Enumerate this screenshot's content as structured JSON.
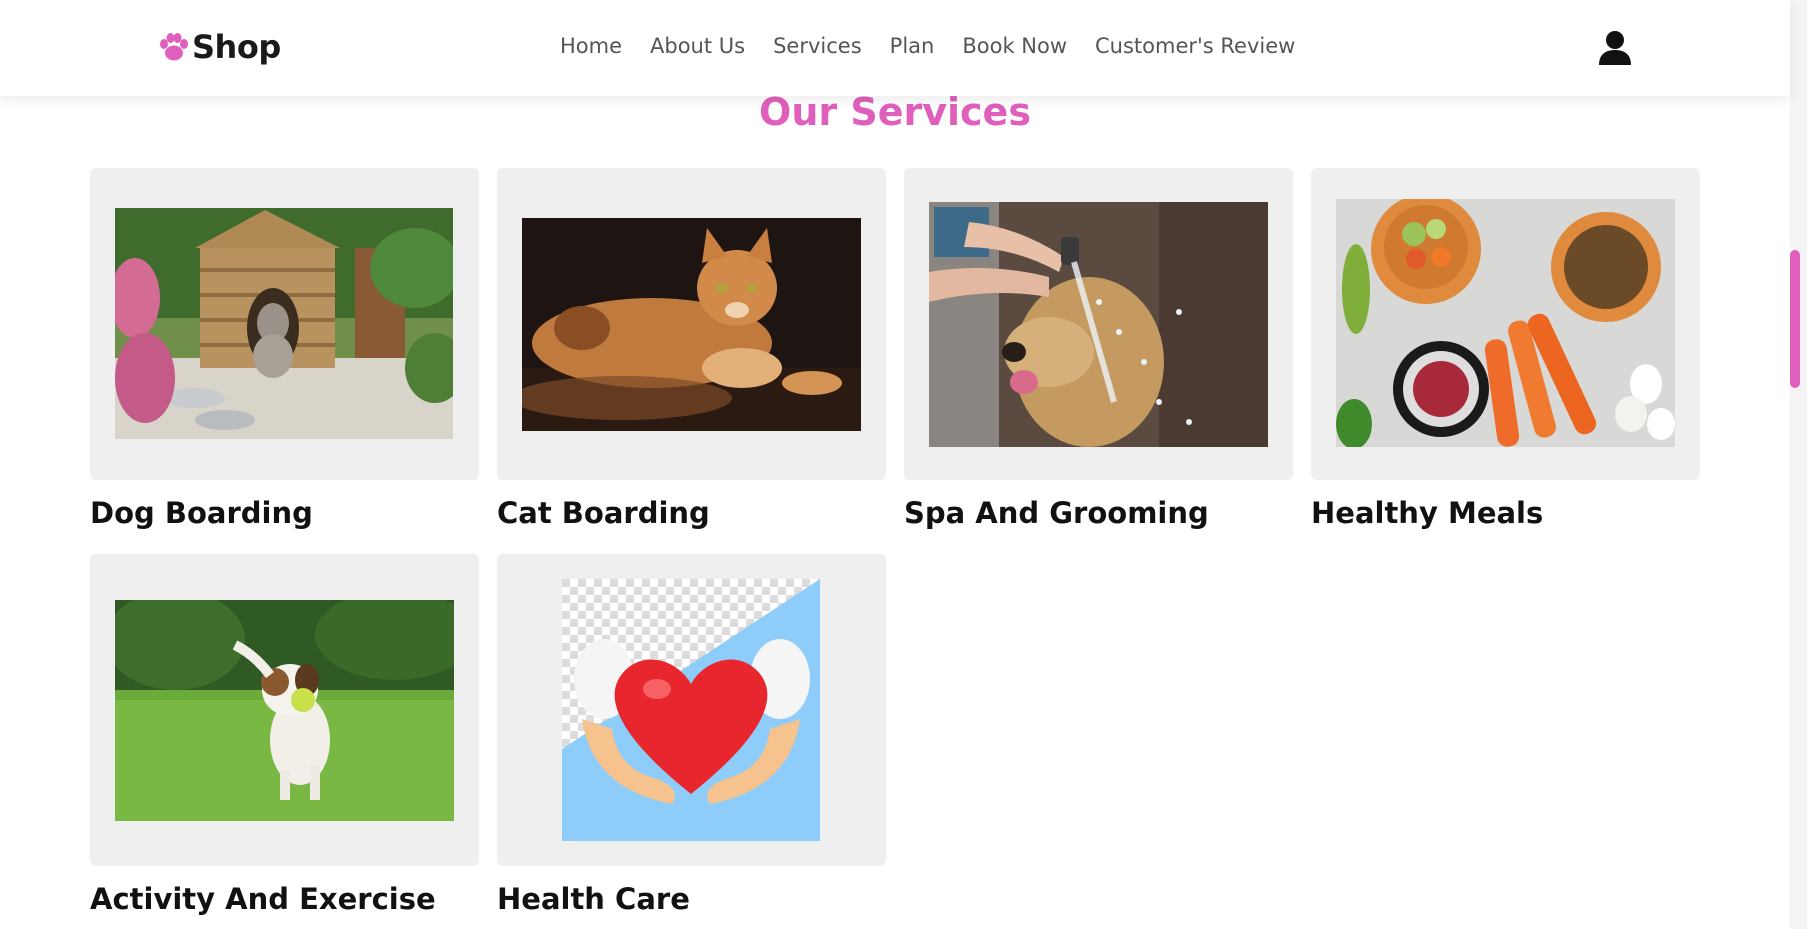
{
  "header": {
    "logo_text": "Shop",
    "nav": [
      "Home",
      "About Us",
      "Services",
      "Plan",
      "Book Now",
      "Customer's Review"
    ]
  },
  "services": {
    "title": "Our Services",
    "cards": [
      {
        "title": "Dog Boarding",
        "image": "dog-kennel-photo"
      },
      {
        "title": "Cat Boarding",
        "image": "orange-cat-photo"
      },
      {
        "title": "Spa And Grooming",
        "image": "dog-shower-photo"
      },
      {
        "title": "Healthy Meals",
        "image": "pet-food-bowls-photo"
      },
      {
        "title": "Activity And Exercise",
        "image": "dog-running-grass-photo"
      },
      {
        "title": "Health Care",
        "image": "heart-in-hands-illustration"
      }
    ]
  },
  "colors": {
    "accent": "#e05fbd",
    "card_bg": "#f0efef",
    "text": "#111111",
    "nav_text": "#555555"
  }
}
